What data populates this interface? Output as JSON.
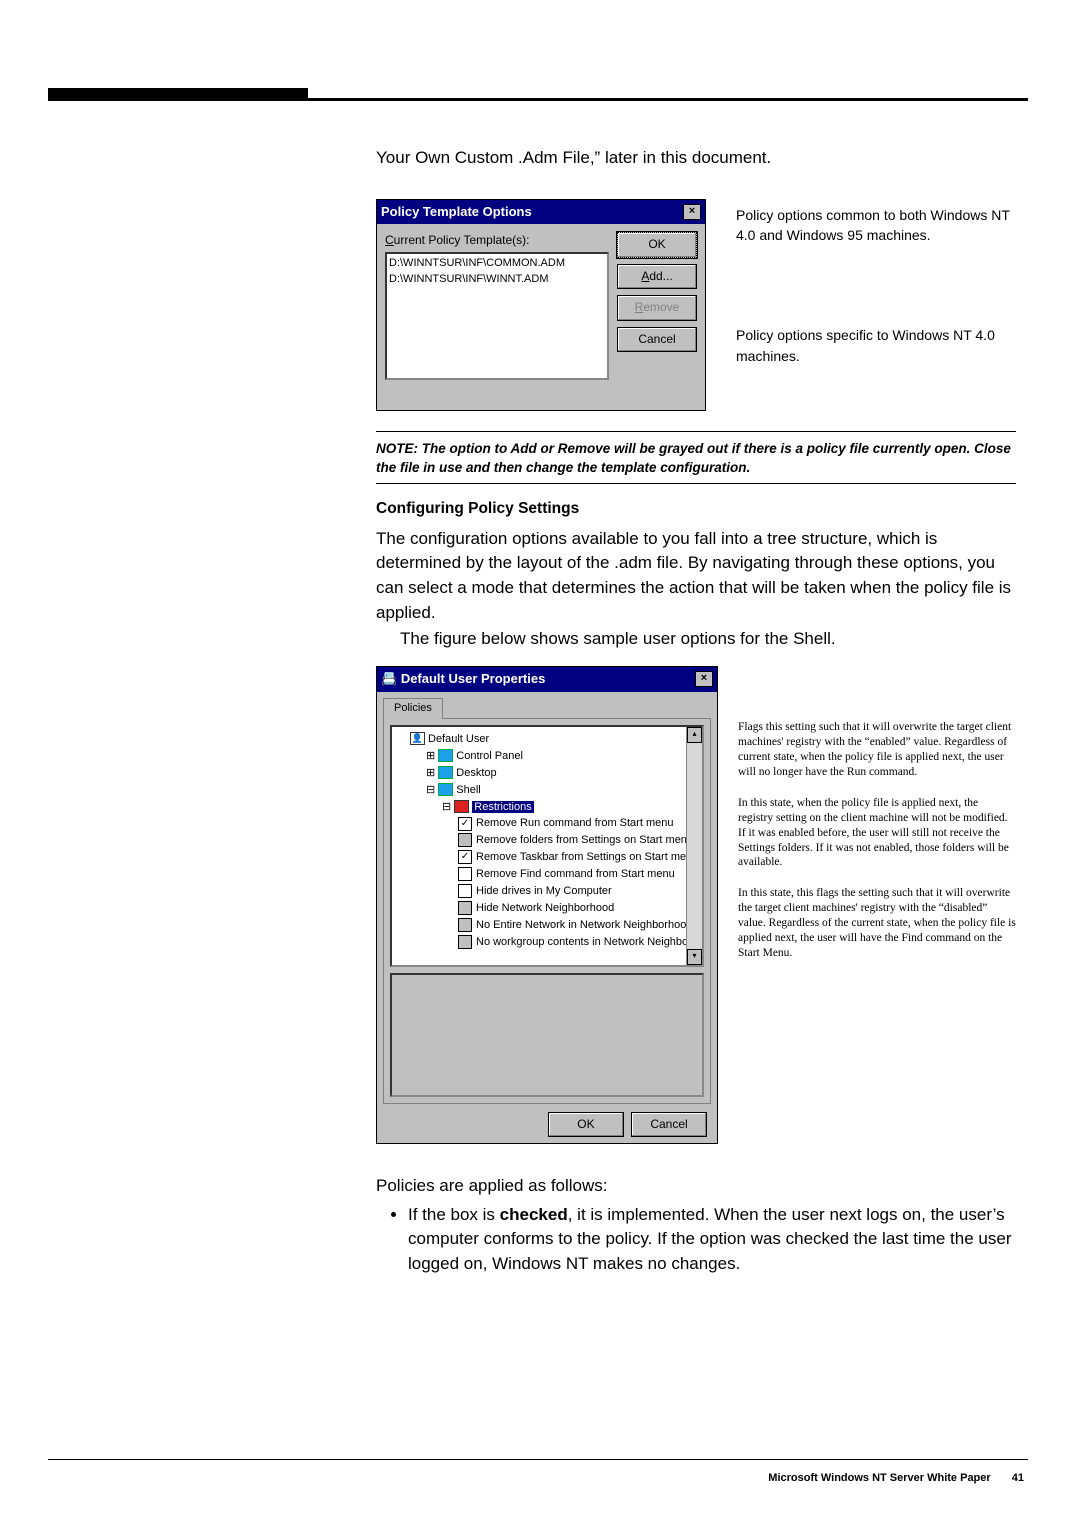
{
  "para_top": "Your Own Custom .Adm File,” later in this document.",
  "dialog1": {
    "title": "Policy Template Options",
    "close": "×",
    "label_html": "Current Policy Template(s):",
    "label_underline": "C",
    "list_item_1": "D:\\WINNTSUR\\INF\\COMMON.ADM",
    "list_item_2": "D:\\WINNTSUR\\INF\\WINNT.ADM",
    "btn_ok": "OK",
    "btn_add": "Add...",
    "btn_add_underline": "A",
    "btn_remove": "Remove",
    "btn_remove_underline": "R",
    "btn_cancel": "Cancel"
  },
  "fig1_note_top": "Policy options common to both Windows NT 4.0 and Windows 95 machines.",
  "fig1_note_bot": "Policy options specific to Windows NT 4.0 machines.",
  "note_block": "NOTE: The option to Add or Remove will be grayed out if there is a policy file currently open. Close the file in use and then change the template configuration.",
  "section_head": "Configuring Policy Settings",
  "para2": "The configuration options available to you fall into a tree structure, which is determined by the layout of the .adm file. By navigating through these options, you can select a mode that determines the action that will be taken when the policy file is applied.",
  "para3": "The figure below shows sample user options for the Shell.",
  "dialog2": {
    "title": "Default User Properties",
    "close": "×",
    "tab": "Policies",
    "root": "Default User",
    "n_control": "Control Panel",
    "n_desktop": "Desktop",
    "n_shell": "Shell",
    "n_restrictions": "Restrictions",
    "opt1": "Remove Run command from Start menu",
    "opt2": "Remove folders from Settings on Start menu",
    "opt3": "Remove Taskbar from Settings on Start menu",
    "opt4": "Remove Find command from Start menu",
    "opt5": "Hide drives in My Computer",
    "opt6": "Hide Network Neighborhood",
    "opt7": "No Entire Network in Network Neighborhood",
    "opt8": "No workgroup contents in Network Neighborhood",
    "btn_ok": "OK",
    "btn_cancel": "Cancel"
  },
  "fig2_note1": "Flags this setting such that it will overwrite the target client machines' registry with the “enabled” value. Regardless of current state, when the policy file is applied next, the user will no longer have the Run command.",
  "fig2_note2": "In this state, when the policy file is applied next, the registry setting on the client machine will not be modified. If it was enabled before, the user will still not receive the Settings folders. If it was not enabled, those folders will be available.",
  "fig2_note3": "In this state, this flags the setting such that it will overwrite the target client machines' registry with the “disabled” value. Regardless of the current state, when the policy file is applied next, the user will have the Find command on the Start Menu.",
  "para4": "Policies are applied as follows:",
  "bullet1_pre": "If the box is ",
  "bullet1_bold": "checked",
  "bullet1_post": ", it is implemented. When the user next logs on, the user’s computer conforms to the policy. If the option was checked the last time the user logged on, Windows NT makes no changes.",
  "footer_title": "Microsoft Windows NT Server White Paper",
  "footer_page": "41"
}
